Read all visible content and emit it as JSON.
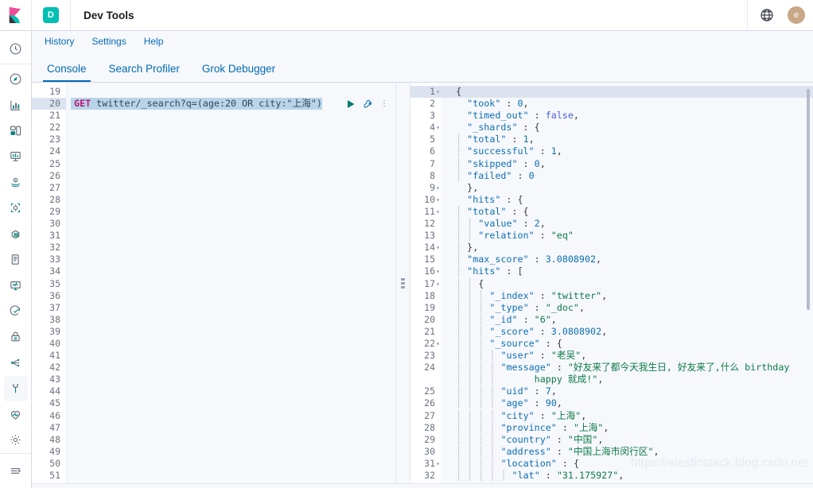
{
  "header": {
    "logo_name": "kibana-logo",
    "app_badge": "D",
    "title": "Dev Tools",
    "help_icon": "globe-help-icon",
    "avatar_initial": "e"
  },
  "sidebar": {
    "items": [
      {
        "icon": "recently-viewed-clock-icon",
        "active": false
      },
      {
        "icon": "discover-compass-icon",
        "active": false
      },
      {
        "icon": "visualize-chart-icon",
        "active": false
      },
      {
        "icon": "dashboard-icon",
        "active": false
      },
      {
        "icon": "canvas-easel-icon",
        "active": false
      },
      {
        "icon": "maps-icon",
        "active": false
      },
      {
        "icon": "machine-learning-icon",
        "active": false
      },
      {
        "icon": "infrastructure-icon",
        "active": false
      },
      {
        "icon": "logs-scroll-icon",
        "active": false
      },
      {
        "icon": "apm-monitor-icon",
        "active": false
      },
      {
        "icon": "uptime-icon",
        "active": false
      },
      {
        "icon": "siem-lock-icon",
        "active": false
      },
      {
        "icon": "graph-share-icon",
        "active": false
      },
      {
        "icon": "dev-tools-wrench-icon",
        "active": true
      },
      {
        "icon": "monitoring-heartbeat-icon",
        "active": false
      },
      {
        "icon": "management-gear-icon",
        "active": false
      }
    ],
    "collapse_icon": "collapse-nav-icon"
  },
  "console": {
    "menu": [
      {
        "label": "History"
      },
      {
        "label": "Settings"
      },
      {
        "label": "Help"
      }
    ],
    "tabs": [
      {
        "label": "Console",
        "active": true
      },
      {
        "label": "Search Profiler",
        "active": false
      },
      {
        "label": "Grok Debugger",
        "active": false
      }
    ]
  },
  "request_editor": {
    "first_line_number": 19,
    "last_line_number": 51,
    "active_line_number": 20,
    "query_method": "GET",
    "query_rest": " twitter/_search?q=(age:20 OR city:\"上海\")",
    "play_icon": "run-query-play-icon",
    "wrench_icon": "request-options-wrench-icon",
    "kebab_icon": "more-actions-icon"
  },
  "response_editor": {
    "lines": [
      {
        "num": 1,
        "fold": true,
        "indent": 0,
        "tokens": [
          {
            "t": "{",
            "c": "p"
          }
        ],
        "hl": true
      },
      {
        "num": 2,
        "fold": false,
        "indent": 0,
        "tokens": [
          {
            "t": "  \"took\"",
            "c": "k"
          },
          {
            "t": " : ",
            "c": "p"
          },
          {
            "t": "0",
            "c": "n"
          },
          {
            "t": ",",
            "c": "p"
          }
        ]
      },
      {
        "num": 3,
        "fold": false,
        "indent": 0,
        "tokens": [
          {
            "t": "  \"timed_out\"",
            "c": "k"
          },
          {
            "t": " : ",
            "c": "p"
          },
          {
            "t": "false",
            "c": "b"
          },
          {
            "t": ",",
            "c": "p"
          }
        ]
      },
      {
        "num": 4,
        "fold": true,
        "indent": 0,
        "tokens": [
          {
            "t": "  \"_shards\"",
            "c": "k"
          },
          {
            "t": " : {",
            "c": "p"
          }
        ]
      },
      {
        "num": 5,
        "fold": false,
        "indent": 1,
        "tokens": [
          {
            "t": "\"total\"",
            "c": "k"
          },
          {
            "t": " : ",
            "c": "p"
          },
          {
            "t": "1",
            "c": "n"
          },
          {
            "t": ",",
            "c": "p"
          }
        ]
      },
      {
        "num": 6,
        "fold": false,
        "indent": 1,
        "tokens": [
          {
            "t": "\"successful\"",
            "c": "k"
          },
          {
            "t": " : ",
            "c": "p"
          },
          {
            "t": "1",
            "c": "n"
          },
          {
            "t": ",",
            "c": "p"
          }
        ]
      },
      {
        "num": 7,
        "fold": false,
        "indent": 1,
        "tokens": [
          {
            "t": "\"skipped\"",
            "c": "k"
          },
          {
            "t": " : ",
            "c": "p"
          },
          {
            "t": "0",
            "c": "n"
          },
          {
            "t": ",",
            "c": "p"
          }
        ]
      },
      {
        "num": 8,
        "fold": false,
        "indent": 1,
        "tokens": [
          {
            "t": "\"failed\"",
            "c": "k"
          },
          {
            "t": " : ",
            "c": "p"
          },
          {
            "t": "0",
            "c": "n"
          }
        ]
      },
      {
        "num": 9,
        "fold": true,
        "indent": 0,
        "tokens": [
          {
            "t": "  },",
            "c": "p"
          }
        ]
      },
      {
        "num": 10,
        "fold": true,
        "indent": 0,
        "tokens": [
          {
            "t": "  \"hits\"",
            "c": "k"
          },
          {
            "t": " : {",
            "c": "p"
          }
        ]
      },
      {
        "num": 11,
        "fold": true,
        "indent": 1,
        "tokens": [
          {
            "t": "\"total\"",
            "c": "k"
          },
          {
            "t": " : {",
            "c": "p"
          }
        ]
      },
      {
        "num": 12,
        "fold": false,
        "indent": 2,
        "tokens": [
          {
            "t": "\"value\"",
            "c": "k"
          },
          {
            "t": " : ",
            "c": "p"
          },
          {
            "t": "2",
            "c": "n"
          },
          {
            "t": ",",
            "c": "p"
          }
        ]
      },
      {
        "num": 13,
        "fold": false,
        "indent": 2,
        "tokens": [
          {
            "t": "\"relation\"",
            "c": "k"
          },
          {
            "t": " : ",
            "c": "p"
          },
          {
            "t": "\"eq\"",
            "c": "s"
          }
        ]
      },
      {
        "num": 14,
        "fold": true,
        "indent": 1,
        "tokens": [
          {
            "t": "},",
            "c": "p"
          }
        ]
      },
      {
        "num": 15,
        "fold": false,
        "indent": 1,
        "tokens": [
          {
            "t": "\"max_score\"",
            "c": "k"
          },
          {
            "t": " : ",
            "c": "p"
          },
          {
            "t": "3.0808902",
            "c": "n"
          },
          {
            "t": ",",
            "c": "p"
          }
        ]
      },
      {
        "num": 16,
        "fold": true,
        "indent": 1,
        "tokens": [
          {
            "t": "\"hits\"",
            "c": "k"
          },
          {
            "t": " : [",
            "c": "p"
          }
        ]
      },
      {
        "num": 17,
        "fold": true,
        "indent": 2,
        "tokens": [
          {
            "t": "{",
            "c": "p"
          }
        ]
      },
      {
        "num": 18,
        "fold": false,
        "indent": 3,
        "tokens": [
          {
            "t": "\"_index\"",
            "c": "k"
          },
          {
            "t": " : ",
            "c": "p"
          },
          {
            "t": "\"twitter\"",
            "c": "s"
          },
          {
            "t": ",",
            "c": "p"
          }
        ]
      },
      {
        "num": 19,
        "fold": false,
        "indent": 3,
        "tokens": [
          {
            "t": "\"_type\"",
            "c": "k"
          },
          {
            "t": " : ",
            "c": "p"
          },
          {
            "t": "\"_doc\"",
            "c": "s"
          },
          {
            "t": ",",
            "c": "p"
          }
        ]
      },
      {
        "num": 20,
        "fold": false,
        "indent": 3,
        "tokens": [
          {
            "t": "\"_id\"",
            "c": "k"
          },
          {
            "t": " : ",
            "c": "p"
          },
          {
            "t": "\"6\"",
            "c": "s"
          },
          {
            "t": ",",
            "c": "p"
          }
        ]
      },
      {
        "num": 21,
        "fold": false,
        "indent": 3,
        "tokens": [
          {
            "t": "\"_score\"",
            "c": "k"
          },
          {
            "t": " : ",
            "c": "p"
          },
          {
            "t": "3.0808902",
            "c": "n"
          },
          {
            "t": ",",
            "c": "p"
          }
        ]
      },
      {
        "num": 22,
        "fold": true,
        "indent": 3,
        "tokens": [
          {
            "t": "\"_source\"",
            "c": "k"
          },
          {
            "t": " : {",
            "c": "p"
          }
        ]
      },
      {
        "num": 23,
        "fold": false,
        "indent": 4,
        "tokens": [
          {
            "t": "\"user\"",
            "c": "k"
          },
          {
            "t": " : ",
            "c": "p"
          },
          {
            "t": "\"老吴\"",
            "c": "s"
          },
          {
            "t": ",",
            "c": "p"
          }
        ]
      },
      {
        "num": 24,
        "fold": false,
        "indent": 4,
        "wrap": true,
        "tokens": [
          {
            "t": "\"message\"",
            "c": "k"
          },
          {
            "t": " : ",
            "c": "p"
          },
          {
            "t": "\"好友来了都今天我生日, 好友来了,什么 birthday",
            "c": "s"
          }
        ],
        "tokens2": [
          {
            "t": "  happy 就成!\"",
            "c": "s"
          },
          {
            "t": ",",
            "c": "p"
          }
        ]
      },
      {
        "num": 25,
        "fold": false,
        "indent": 4,
        "tokens": [
          {
            "t": "\"uid\"",
            "c": "k"
          },
          {
            "t": " : ",
            "c": "p"
          },
          {
            "t": "7",
            "c": "n"
          },
          {
            "t": ",",
            "c": "p"
          }
        ]
      },
      {
        "num": 26,
        "fold": false,
        "indent": 4,
        "tokens": [
          {
            "t": "\"age\"",
            "c": "k"
          },
          {
            "t": " : ",
            "c": "p"
          },
          {
            "t": "90",
            "c": "n"
          },
          {
            "t": ",",
            "c": "p"
          }
        ]
      },
      {
        "num": 27,
        "fold": false,
        "indent": 4,
        "tokens": [
          {
            "t": "\"city\"",
            "c": "k"
          },
          {
            "t": " : ",
            "c": "p"
          },
          {
            "t": "\"上海\"",
            "c": "s"
          },
          {
            "t": ",",
            "c": "p"
          }
        ]
      },
      {
        "num": 28,
        "fold": false,
        "indent": 4,
        "tokens": [
          {
            "t": "\"province\"",
            "c": "k"
          },
          {
            "t": " : ",
            "c": "p"
          },
          {
            "t": "\"上海\"",
            "c": "s"
          },
          {
            "t": ",",
            "c": "p"
          }
        ]
      },
      {
        "num": 29,
        "fold": false,
        "indent": 4,
        "tokens": [
          {
            "t": "\"country\"",
            "c": "k"
          },
          {
            "t": " : ",
            "c": "p"
          },
          {
            "t": "\"中国\"",
            "c": "s"
          },
          {
            "t": ",",
            "c": "p"
          }
        ]
      },
      {
        "num": 30,
        "fold": false,
        "indent": 4,
        "tokens": [
          {
            "t": "\"address\"",
            "c": "k"
          },
          {
            "t": " : ",
            "c": "p"
          },
          {
            "t": "\"中国上海市闵行区\"",
            "c": "s"
          },
          {
            "t": ",",
            "c": "p"
          }
        ]
      },
      {
        "num": 31,
        "fold": true,
        "indent": 4,
        "tokens": [
          {
            "t": "\"location\"",
            "c": "k"
          },
          {
            "t": " : {",
            "c": "p"
          }
        ]
      },
      {
        "num": 32,
        "fold": false,
        "indent": 5,
        "tokens": [
          {
            "t": "\"lat\"",
            "c": "k"
          },
          {
            "t": " : ",
            "c": "p"
          },
          {
            "t": "\"31.175927\"",
            "c": "s"
          },
          {
            "t": ",",
            "c": "p"
          }
        ]
      }
    ]
  },
  "watermark": "https://elasticstack.blog.csdn.net",
  "colors": {
    "accent_blue": "#006bb4",
    "teal": "#00bfb3",
    "pink": "#f04e98",
    "string_green": "#0a7a46",
    "key_blue": "#0b6fb4",
    "bool_purple": "#4b5bd7",
    "selection": "#b9d4e8",
    "line_highlight": "#dde3ee"
  }
}
